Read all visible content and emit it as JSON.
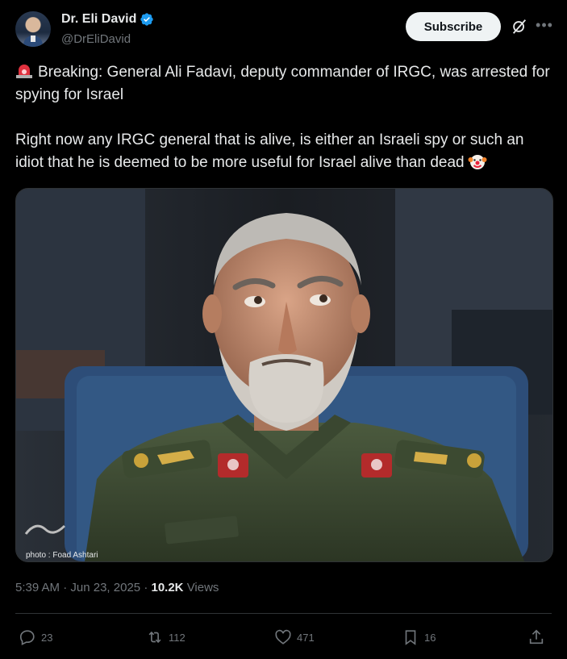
{
  "author": {
    "display_name": "Dr. Eli David",
    "handle": "@DrEliDavid",
    "verified": true
  },
  "header": {
    "subscribe_label": "Subscribe",
    "grok_icon": "grok-icon",
    "more_icon": "more-options-icon"
  },
  "tweet": {
    "line1": "Breaking: General Ali Fadavi, deputy commander of IRGC, was arrested for spying for Israel",
    "line2": "Right now any IRGC general that is alive, is either an Israeli spy or such an idiot that he is deemed to be more useful for Israel alive than dead",
    "emoji_start": "rotating-light-icon",
    "emoji_end": "clown-face-icon"
  },
  "media": {
    "photo_credit": "photo : Foad Ashtari"
  },
  "meta": {
    "time": "5:39 AM",
    "separator": "·",
    "date": "Jun 23, 2025",
    "views_count": "10.2K",
    "views_label": "Views"
  },
  "actions": {
    "replies": "23",
    "reposts": "112",
    "likes": "471",
    "bookmarks": "16"
  },
  "colors": {
    "background": "#000000",
    "text": "#e7e9ea",
    "secondary": "#71767b",
    "verified": "#1d9bf0",
    "divider": "#2f3336"
  }
}
